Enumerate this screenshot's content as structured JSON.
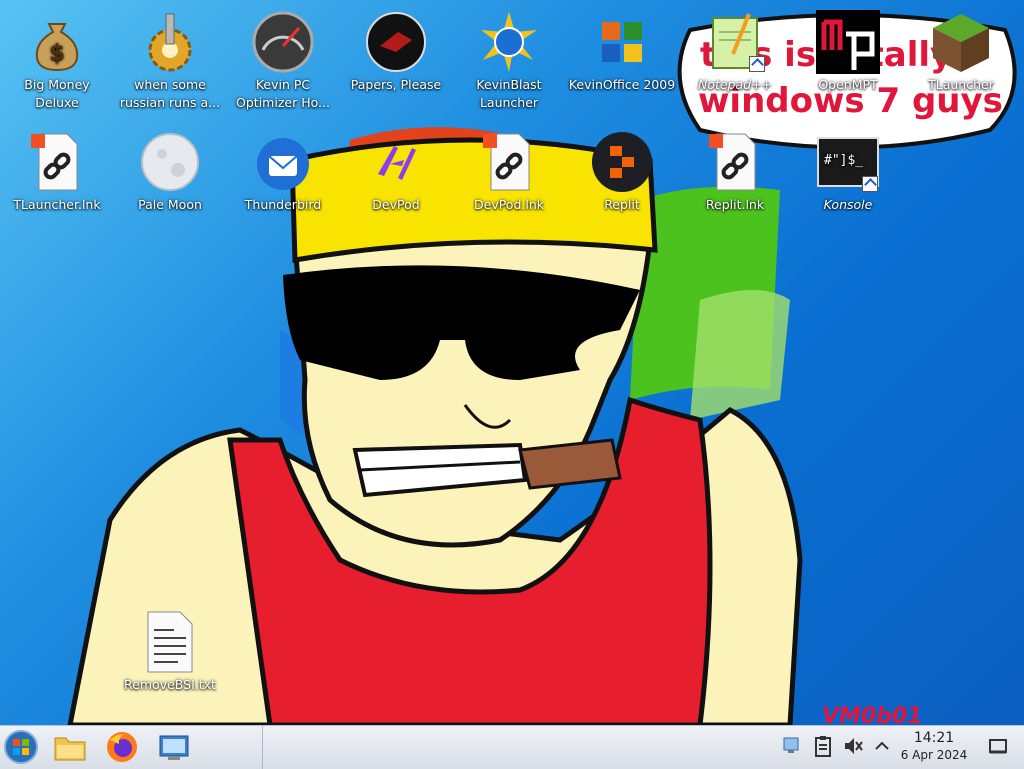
{
  "desktop_icons": [
    {
      "label": "Big Money Deluxe",
      "icon": "money-bag-icon"
    },
    {
      "label": "when some russian runs a...",
      "icon": "gear-gold-icon"
    },
    {
      "label": "Kevin PC Optimizer Ho...",
      "icon": "speedometer-icon"
    },
    {
      "label": "Papers, Please",
      "icon": "papers-please-icon"
    },
    {
      "label": "KevinBlast Launcher",
      "icon": "globe-burst-icon"
    },
    {
      "label": "KevinOffice 2009",
      "icon": "office-logo-icon"
    },
    {
      "label": "Notepad++",
      "icon": "notepad-plus-plus-icon"
    },
    {
      "label": "OpenMPT",
      "icon": "openmpt-icon"
    },
    {
      "label": "TLauncher",
      "icon": "grass-block-icon"
    },
    {
      "label": "TLauncher.lnk",
      "icon": "link-file-icon"
    },
    {
      "label": "Pale Moon",
      "icon": "moon-icon"
    },
    {
      "label": "Thunderbird",
      "icon": "thunderbird-icon"
    },
    {
      "label": "DevPod",
      "icon": "devpod-icon"
    },
    {
      "label": "DevPod.lnk",
      "icon": "link-file-icon"
    },
    {
      "label": "Replit",
      "icon": "replit-icon"
    },
    {
      "label": "Replit.lnk",
      "icon": "link-file-icon"
    },
    {
      "label": "Konsole",
      "icon": "terminal-icon"
    },
    {
      "label": "RemoveBSI.txt",
      "icon": "text-file-icon"
    }
  ],
  "wallpaper": {
    "caption_line1": "this is totally",
    "caption_line2": "windows 7 guys",
    "watermark": "VM0b01"
  },
  "taskbar": {
    "apps": [
      {
        "name": "Start",
        "icon": "windows-start-icon"
      },
      {
        "name": "File Manager",
        "icon": "folder-icon"
      },
      {
        "name": "Firefox",
        "icon": "firefox-icon"
      },
      {
        "name": "System Settings",
        "icon": "control-panel-icon"
      }
    ],
    "tray": [
      "network-icon",
      "clipboard-icon",
      "volume-muted-icon",
      "chevron-up-icon",
      "show-desktop-icon"
    ],
    "clock_time": "14:21",
    "clock_date": "6 Apr 2024"
  },
  "colors": {
    "accent_red": "#e0163a",
    "taskbar_bg": "#dfe3ea",
    "desktop_blue": "#0a6fd2"
  }
}
